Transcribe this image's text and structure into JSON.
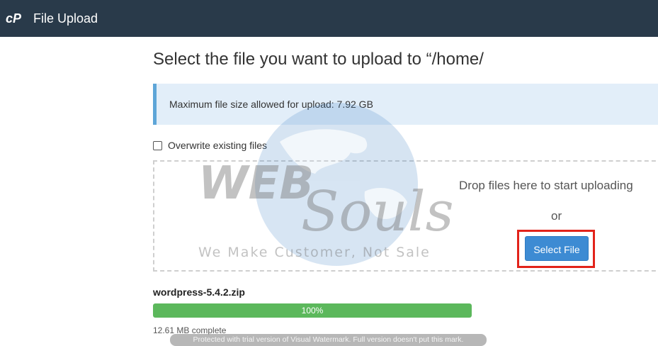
{
  "header": {
    "logo_icon": "cpanel-logo-icon",
    "title": "File Upload",
    "background": "#293a4a"
  },
  "main": {
    "heading": "Select the file you want to upload to “/home/",
    "info_message": "Maximum file size allowed for upload: 7.92 GB",
    "overwrite_label": "Overwrite existing files",
    "overwrite_checked": false,
    "dropzone": {
      "text": "Drop files here to start uploading",
      "or_text": "or",
      "select_button": "Select File",
      "highlight_color": "#e2231a"
    },
    "upload": {
      "file_name": "wordpress-5.4.2.zip",
      "progress_percent": 100,
      "progress_label": "100%",
      "status": "12.61 MB complete",
      "progress_color": "#5cb85c"
    }
  },
  "watermark": {
    "brand_top": "WEB",
    "brand_script": "Souls",
    "tagline": "We Make Customer, Not Sale",
    "trial_notice": "Protected with trial version of Visual Watermark. Full version doesn't put this mark."
  },
  "colors": {
    "accent": "#3d8bd3",
    "info_bg": "#e2eef9",
    "info_border": "#5ea6d8"
  }
}
